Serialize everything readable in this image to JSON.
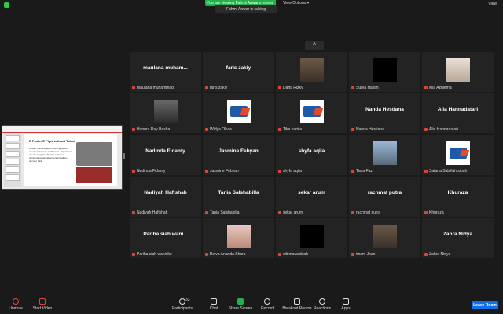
{
  "top": {
    "banner": "You are viewing Fahmi Anwar's screen",
    "view_options": "View Options ▾",
    "view": "View",
    "speaker": "Fahmi Anwar is talking"
  },
  "share": {
    "slide_title": "E Poster/E Flyer without Talent",
    "slide_text": "Desain memiliki peran penting dalam membuat konsep multimedia. Diperlukan desain yang kreatif, rapi, kekinian sehingga pesan dapat tersampaikan dengan baik."
  },
  "tiles": [
    {
      "display": "maulana  muham...",
      "label": "maulana muhammad",
      "video": "none"
    },
    {
      "display": "faris zakiy",
      "label": "faris zakiy",
      "video": "none"
    },
    {
      "display": "",
      "label": "Daffa Rizky",
      "video": "photo"
    },
    {
      "display": "",
      "label": "Surya Hakim",
      "video": "black"
    },
    {
      "display": "",
      "label": "Mia Azhiema",
      "video": "light"
    },
    {
      "display": "",
      "label": "Hanura Ray Basha",
      "video": "dark"
    },
    {
      "display": "",
      "label": "Widya Olivia",
      "video": "logo"
    },
    {
      "display": "",
      "label": "Tika nabila",
      "video": "logo"
    },
    {
      "display": "Nanda Hestiana",
      "label": "Nanda Hestiana",
      "video": "none"
    },
    {
      "display": "Alia Hannadatari",
      "label": "Alia Hannadatari",
      "video": "none"
    },
    {
      "display": "Nadinda Fidanty",
      "label": "Nadinda Fidanty",
      "video": "none"
    },
    {
      "display": "Jasmine Febyan",
      "label": "Jasmine Febyan",
      "video": "none"
    },
    {
      "display": "shyfa aqila",
      "label": "shyfa aqila",
      "video": "none"
    },
    {
      "display": "",
      "label": "Tiara Fazi",
      "video": "sky"
    },
    {
      "display": "",
      "label": "Safana Sabillah sipah",
      "video": "logo"
    },
    {
      "display": "Nadiyah Hafishah",
      "label": "Nadiyah Hafishah",
      "video": "none"
    },
    {
      "display": "Tania Salshabilla",
      "label": "Tania Salshabilla",
      "video": "none"
    },
    {
      "display": "sekar arum",
      "label": "sekar arum",
      "video": "none"
    },
    {
      "display": "rachmat putra",
      "label": "rachmat putra",
      "video": "none"
    },
    {
      "display": "Khuraza",
      "label": "Khuraza",
      "video": "none"
    },
    {
      "display": "Pariha siah wani...",
      "label": "Pariha siah wanirike",
      "video": "none"
    },
    {
      "display": "",
      "label": "Belva Ananda Shara",
      "video": "pink"
    },
    {
      "display": "",
      "label": "siti mawaddah",
      "video": "black"
    },
    {
      "display": "",
      "label": "imam Joan",
      "video": "photo"
    },
    {
      "display": "Zahra Nidya",
      "label": "Zahra Nidya",
      "video": "none"
    }
  ],
  "toolbar": {
    "unmute": "Unmute",
    "start_video": "Start Video",
    "participants": "Participants",
    "participants_count": "33",
    "chat": "Chat",
    "share_screen": "Share Screen",
    "record": "Record",
    "breakout": "Breakout Rooms",
    "reactions": "Reactions",
    "apps": "Apps",
    "leave": "Leave Room"
  }
}
